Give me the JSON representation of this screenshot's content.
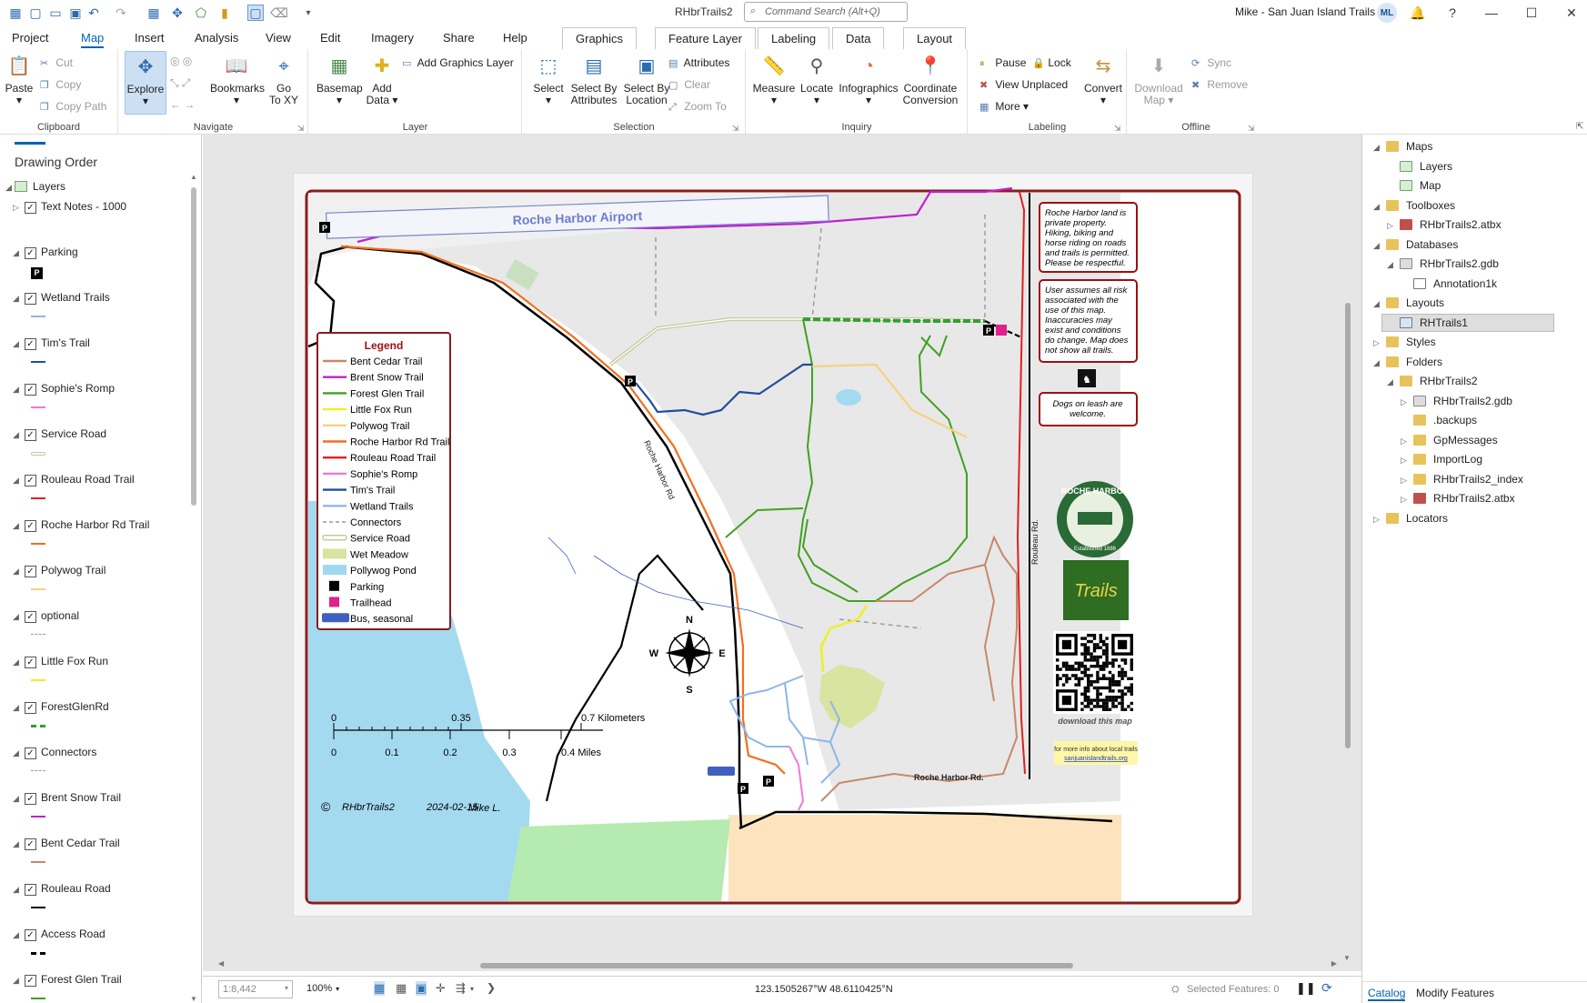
{
  "app": {
    "doc_title": "RHbrTrails2",
    "search_placeholder": "Command Search (Alt+Q)",
    "user": "Mike - San Juan Island Trails",
    "avatar_initials": "ML"
  },
  "tabs": [
    "Project",
    "Map",
    "Insert",
    "Analysis",
    "View",
    "Edit",
    "Imagery",
    "Share",
    "Help"
  ],
  "context_tabs": {
    "graphics": "Graphics",
    "feature_layer": "Feature Layer",
    "labeling": "Labeling",
    "data": "Data",
    "layout": "Layout"
  },
  "ribbon": {
    "clipboard": {
      "label": "Clipboard",
      "paste": "Paste",
      "cut": "Cut",
      "copy": "Copy",
      "copy_path": "Copy Path"
    },
    "navigate": {
      "label": "Navigate",
      "explore": "Explore",
      "bookmarks": "Bookmarks",
      "go": "Go",
      "to_xy": "To XY"
    },
    "layer": {
      "label": "Layer",
      "basemap": "Basemap",
      "add": "Add",
      "data": "Data",
      "add_graphics": "Add Graphics Layer"
    },
    "selection": {
      "label": "Selection",
      "select": "Select",
      "select_by": "Select By",
      "attributes": "Attributes",
      "location": "Location",
      "attributes_btn": "Attributes",
      "clear": "Clear",
      "zoom_to": "Zoom To"
    },
    "inquiry": {
      "label": "Inquiry",
      "measure": "Measure",
      "locate": "Locate",
      "infographics": "Infographics",
      "coordinate": "Coordinate",
      "conversion": "Conversion"
    },
    "labeling": {
      "label": "Labeling",
      "pause": "Pause",
      "lock": "Lock",
      "view_unplaced": "View Unplaced",
      "more": "More",
      "convert": "Convert"
    },
    "offline": {
      "label": "Offline",
      "download": "Download",
      "map": "Map",
      "sync": "Sync",
      "remove": "Remove"
    }
  },
  "drawing_order": {
    "title": "Drawing Order",
    "root": "Layers",
    "layers": [
      {
        "name": "Text Notes - 1000",
        "color": "",
        "style": "none"
      },
      {
        "name": "Parking",
        "color": "#000000",
        "style": "p"
      },
      {
        "name": "Wetland Trails",
        "color": "#8fb5e8",
        "style": "line"
      },
      {
        "name": "Tim's Trail",
        "color": "#1f4e9c",
        "style": "line"
      },
      {
        "name": "Sophie's Romp",
        "color": "#f07ad6",
        "style": "line"
      },
      {
        "name": "Service Road",
        "color": "#c8c8a0",
        "style": "double"
      },
      {
        "name": "Rouleau Road Trail",
        "color": "#e02020",
        "style": "line"
      },
      {
        "name": "Roche Harbor Rd Trail",
        "color": "#f07020",
        "style": "line"
      },
      {
        "name": "Polywog Trail",
        "color": "#f8d080",
        "style": "line"
      },
      {
        "name": "optional",
        "color": "#999999",
        "style": "dash"
      },
      {
        "name": "Little Fox Run",
        "color": "#f0f020",
        "style": "line"
      },
      {
        "name": "ForestGlenRd",
        "color": "#30a030",
        "style": "dashbold"
      },
      {
        "name": "Connectors",
        "color": "#999999",
        "style": "dash"
      },
      {
        "name": "Brent Snow Trail",
        "color": "#c020d0",
        "style": "line"
      },
      {
        "name": "Bent Cedar Trail",
        "color": "#c88868",
        "style": "line"
      },
      {
        "name": "Rouleau Road",
        "color": "#000000",
        "style": "line"
      },
      {
        "name": "Access Road",
        "color": "#000000",
        "style": "dashbold"
      },
      {
        "name": "Forest Glen Trail",
        "color": "#40a020",
        "style": "line"
      }
    ]
  },
  "layout_map": {
    "airport": "Roche Harbor Airport",
    "legend_title": "Legend",
    "legend": [
      {
        "label": "Bent Cedar Trail",
        "color": "#c88868",
        "style": "line"
      },
      {
        "label": "Brent Snow Trail",
        "color": "#c020d0",
        "style": "line"
      },
      {
        "label": "Forest Glen Trail",
        "color": "#40a020",
        "style": "line"
      },
      {
        "label": "Little Fox Run",
        "color": "#f0f020",
        "style": "line"
      },
      {
        "label": "Polywog Trail",
        "color": "#f8d080",
        "style": "line"
      },
      {
        "label": "Roche Harbor Rd Trail",
        "color": "#f07020",
        "style": "line"
      },
      {
        "label": "Rouleau Road Trail",
        "color": "#e02020",
        "style": "line"
      },
      {
        "label": "Sophie's Romp",
        "color": "#f07ad6",
        "style": "line"
      },
      {
        "label": "Tim's Trail",
        "color": "#1f4e9c",
        "style": "line"
      },
      {
        "label": "Wetland Trails",
        "color": "#8fb5e8",
        "style": "line"
      },
      {
        "label": "Connectors",
        "color": "#999999",
        "style": "dash"
      },
      {
        "label": "Service Road",
        "color": "#c8c8a0",
        "style": "double"
      },
      {
        "label": "Wet Meadow",
        "color": "#d8e4a0",
        "style": "box"
      },
      {
        "label": "Pollywog Pond",
        "color": "#a0d8f0",
        "style": "box"
      },
      {
        "label": "Parking",
        "color": "#000000",
        "style": "p"
      },
      {
        "label": "Trailhead",
        "color": "#e0208c",
        "style": "t"
      },
      {
        "label": "Bus, seasonal",
        "color": "#4060c0",
        "style": "bus"
      }
    ],
    "note1": [
      "Roche Harbor land is",
      "private property.",
      "Hiking, biking and",
      "horse riding on roads",
      "and trails is permitted.",
      "Please be respectful."
    ],
    "note2": [
      "User assumes all risk",
      "associated with the",
      "use of this map.",
      "Inaccuracies may",
      "exist and conditions",
      "do change. Map does",
      "not show all trails."
    ],
    "note3": [
      "Dogs on leash are",
      "welcome."
    ],
    "road_roche": "Roche Harbor Rd",
    "road_roche_bottom": "Roche Harbor Rd.",
    "road_rouleau": "Rouleau Rd.",
    "scale_km": [
      "0",
      "0.35",
      "0.7 Kilometers"
    ],
    "scale_mi": [
      "0",
      "0.1",
      "0.2",
      "0.3",
      "0.4 Miles"
    ],
    "compass": {
      "n": "N",
      "s": "S",
      "e": "E",
      "w": "W"
    },
    "copyright": "©",
    "map_name": "RHbrTrails2",
    "map_date": "2024-02-15",
    "author": "Mike L.",
    "logo_text": "ROCHE HARBOR",
    "logo_sub": "Established 1886",
    "trails_logo": "Trails",
    "qr_caption": "download this map",
    "more_info": "for more info about local trails",
    "website": "sanjuanislandtrails.org",
    "p": "P"
  },
  "status": {
    "scale": "1:8,442",
    "zoom": "100%",
    "coords": "123.1505267°W 48.6110425°N",
    "selected": "Selected Features: 0"
  },
  "catalog": {
    "items": [
      {
        "label": "Maps",
        "level": 0,
        "arrow": "◢",
        "icon": "folder"
      },
      {
        "label": "Layers",
        "level": 1,
        "arrow": "",
        "icon": "mapi"
      },
      {
        "label": "Map",
        "level": 1,
        "arrow": "",
        "icon": "mapi"
      },
      {
        "label": "Toolboxes",
        "level": 0,
        "arrow": "◢",
        "icon": "folder"
      },
      {
        "label": "RHbrTrails2.atbx",
        "level": 1,
        "arrow": "▷",
        "icon": "tbx"
      },
      {
        "label": "Databases",
        "level": 0,
        "arrow": "◢",
        "icon": "folder"
      },
      {
        "label": "RHbrTrails2.gdb",
        "level": 1,
        "arrow": "◢",
        "icon": "gdb"
      },
      {
        "label": "Annotation1k",
        "level": 2,
        "arrow": "",
        "icon": "anno"
      },
      {
        "label": "Layouts",
        "level": 0,
        "arrow": "◢",
        "icon": "folder"
      },
      {
        "label": "RHTrails1",
        "level": 1,
        "arrow": "",
        "icon": "lyt"
      },
      {
        "label": "Styles",
        "level": 0,
        "arrow": "▷",
        "icon": "folder"
      },
      {
        "label": "Folders",
        "level": 0,
        "arrow": "◢",
        "icon": "folder"
      },
      {
        "label": "RHbrTrails2",
        "level": 1,
        "arrow": "◢",
        "icon": "folder"
      },
      {
        "label": "RHbrTrails2.gdb",
        "level": 2,
        "arrow": "▷",
        "icon": "gdb"
      },
      {
        "label": ".backups",
        "level": 2,
        "arrow": "",
        "icon": "folder"
      },
      {
        "label": "GpMessages",
        "level": 2,
        "arrow": "▷",
        "icon": "folder"
      },
      {
        "label": "ImportLog",
        "level": 2,
        "arrow": "▷",
        "icon": "folder"
      },
      {
        "label": "RHbrTrails2_index",
        "level": 2,
        "arrow": "▷",
        "icon": "folder"
      },
      {
        "label": "RHbrTrails2.atbx",
        "level": 2,
        "arrow": "▷",
        "icon": "tbx"
      },
      {
        "label": "Locators",
        "level": 0,
        "arrow": "▷",
        "icon": "folder"
      }
    ],
    "tab_catalog": "Catalog",
    "tab_modify": "Modify Features"
  }
}
